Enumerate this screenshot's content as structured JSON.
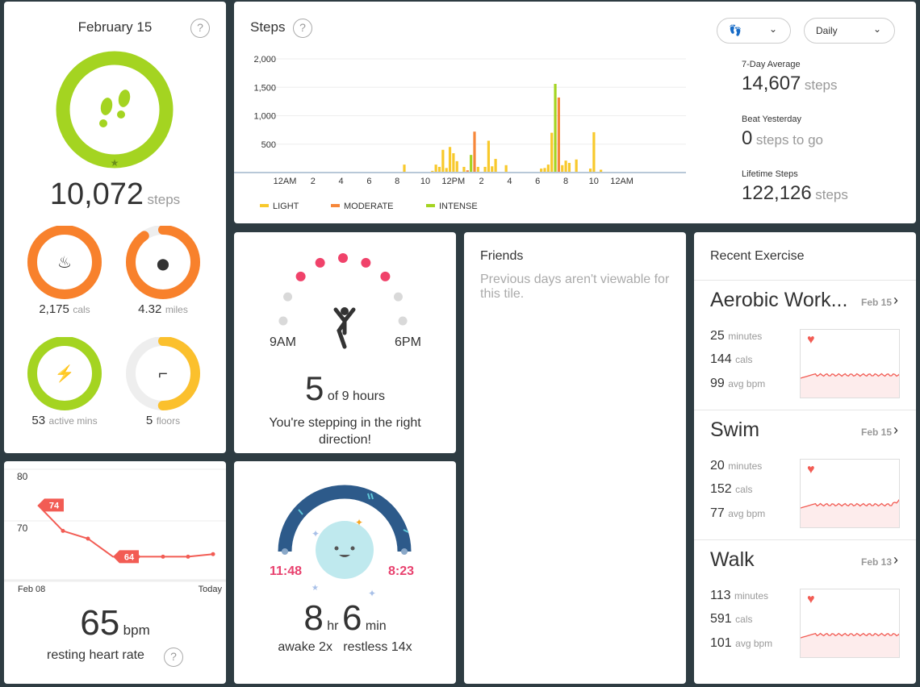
{
  "summary": {
    "date": "February 15",
    "help": "?",
    "steps_value": "10,072",
    "steps_unit": "steps",
    "stats": [
      {
        "value": "2,175",
        "unit": "cals",
        "icon": "flame-icon",
        "color": "#f8812c",
        "fraction": 1.0
      },
      {
        "value": "4.32",
        "unit": "miles",
        "icon": "location-pin-icon",
        "color": "#f8812c",
        "fraction": 0.9
      },
      {
        "value": "53",
        "unit": "active mins",
        "icon": "lightning-icon",
        "color": "#a4d421",
        "fraction": 1.0
      },
      {
        "value": "5",
        "unit": "floors",
        "icon": "stairs-icon",
        "color": "#fbc02d",
        "fraction": 0.5
      }
    ],
    "steps_color": "#a4d421"
  },
  "steps": {
    "title": "Steps",
    "help": "?",
    "activity_select": "footprints-icon",
    "period_select": "Daily",
    "seven_day_label": "7-Day Average",
    "seven_day_value": "14,607",
    "seven_day_unit": "steps",
    "beat_label": "Beat Yesterday",
    "beat_value": "0",
    "beat_unit": "steps to go",
    "lifetime_label": "Lifetime Steps",
    "lifetime_value": "122,126",
    "lifetime_unit": "steps"
  },
  "chart_data": {
    "type": "bar",
    "ylim": [
      0,
      2000
    ],
    "yticks": [
      "2,000",
      "1,500",
      "1,000",
      "500"
    ],
    "ytick_values": [
      2000,
      1500,
      1000,
      500
    ],
    "xticks": [
      "12AM",
      "2",
      "4",
      "6",
      "8",
      "10",
      "12PM",
      "2",
      "4",
      "6",
      "8",
      "10",
      "12AM"
    ],
    "legend": [
      {
        "name": "LIGHT",
        "color": "#f8c92c"
      },
      {
        "name": "MODERATE",
        "color": "#f6873a"
      },
      {
        "name": "INTENSE",
        "color": "#a4d421"
      }
    ],
    "bars": [
      [
        5.2,
        10,
        "LIGHT"
      ],
      [
        8.2,
        10,
        "LIGHT"
      ],
      [
        8.5,
        140,
        "LIGHT"
      ],
      [
        9.5,
        10,
        "LIGHT"
      ],
      [
        9.7,
        10,
        "LIGHT"
      ],
      [
        10.5,
        30,
        "LIGHT"
      ],
      [
        10.75,
        140,
        "LIGHT"
      ],
      [
        11,
        100,
        "LIGHT"
      ],
      [
        11.25,
        400,
        "LIGHT"
      ],
      [
        11.5,
        80,
        "LIGHT"
      ],
      [
        11.75,
        450,
        "LIGHT"
      ],
      [
        12,
        340,
        "LIGHT"
      ],
      [
        12.25,
        200,
        "LIGHT"
      ],
      [
        12.75,
        100,
        "LIGHT"
      ],
      [
        13,
        40,
        "MODERATE"
      ],
      [
        13.25,
        310,
        "INTENSE"
      ],
      [
        13.5,
        720,
        "MODERATE"
      ],
      [
        13.75,
        100,
        "LIGHT"
      ],
      [
        14.25,
        100,
        "LIGHT"
      ],
      [
        14.5,
        560,
        "LIGHT"
      ],
      [
        14.75,
        110,
        "LIGHT"
      ],
      [
        15,
        240,
        "LIGHT"
      ],
      [
        15.75,
        130,
        "LIGHT"
      ],
      [
        17,
        10,
        "LIGHT"
      ],
      [
        18.25,
        70,
        "LIGHT"
      ],
      [
        18.5,
        80,
        "LIGHT"
      ],
      [
        18.75,
        140,
        "LIGHT"
      ],
      [
        19,
        700,
        "LIGHT"
      ],
      [
        19.25,
        1560,
        "INTENSE"
      ],
      [
        19.5,
        1320,
        "MODERATE"
      ],
      [
        19.75,
        130,
        "LIGHT"
      ],
      [
        20,
        210,
        "LIGHT"
      ],
      [
        20.25,
        170,
        "LIGHT"
      ],
      [
        20.75,
        230,
        "LIGHT"
      ],
      [
        21.75,
        70,
        "LIGHT"
      ],
      [
        22,
        710,
        "LIGHT"
      ],
      [
        22.5,
        50,
        "LIGHT"
      ]
    ]
  },
  "hourly": {
    "start": "9AM",
    "end": "6PM",
    "value": "5",
    "of": "of 9 hours",
    "message": "You're stepping in the right direction!",
    "active_hours": 5,
    "total_hours": 9
  },
  "friends": {
    "title": "Friends",
    "message": "Previous days aren't viewable for this tile."
  },
  "exercise": {
    "title": "Recent Exercise",
    "items": [
      {
        "name": "Aerobic Work...",
        "date": "Feb 15",
        "minutes": "25",
        "cals": "144",
        "bpm": "99"
      },
      {
        "name": "Swim",
        "date": "Feb 15",
        "minutes": "20",
        "cals": "152",
        "bpm": "77"
      },
      {
        "name": "Walk",
        "date": "Feb 13",
        "minutes": "113",
        "cals": "591",
        "bpm": "101"
      }
    ],
    "minutes_unit": "minutes",
    "cals_unit": "cals",
    "bpm_unit": "avg bpm"
  },
  "heart": {
    "yticks": [
      "80",
      "70"
    ],
    "start": "Feb 08",
    "end": "Today",
    "values": [
      74,
      69,
      67.5,
      64,
      64,
      64,
      64,
      64.5
    ],
    "label_high": "74",
    "label_low": "64",
    "value": "65",
    "unit": "bpm",
    "label": "resting heart rate",
    "help": "?"
  },
  "sleep": {
    "bed": "11:48",
    "wake": "8:23",
    "hours": "8",
    "hr": "hr",
    "minutes": "6",
    "min": "min",
    "awake": "awake 2x",
    "restless": "restless 14x"
  }
}
